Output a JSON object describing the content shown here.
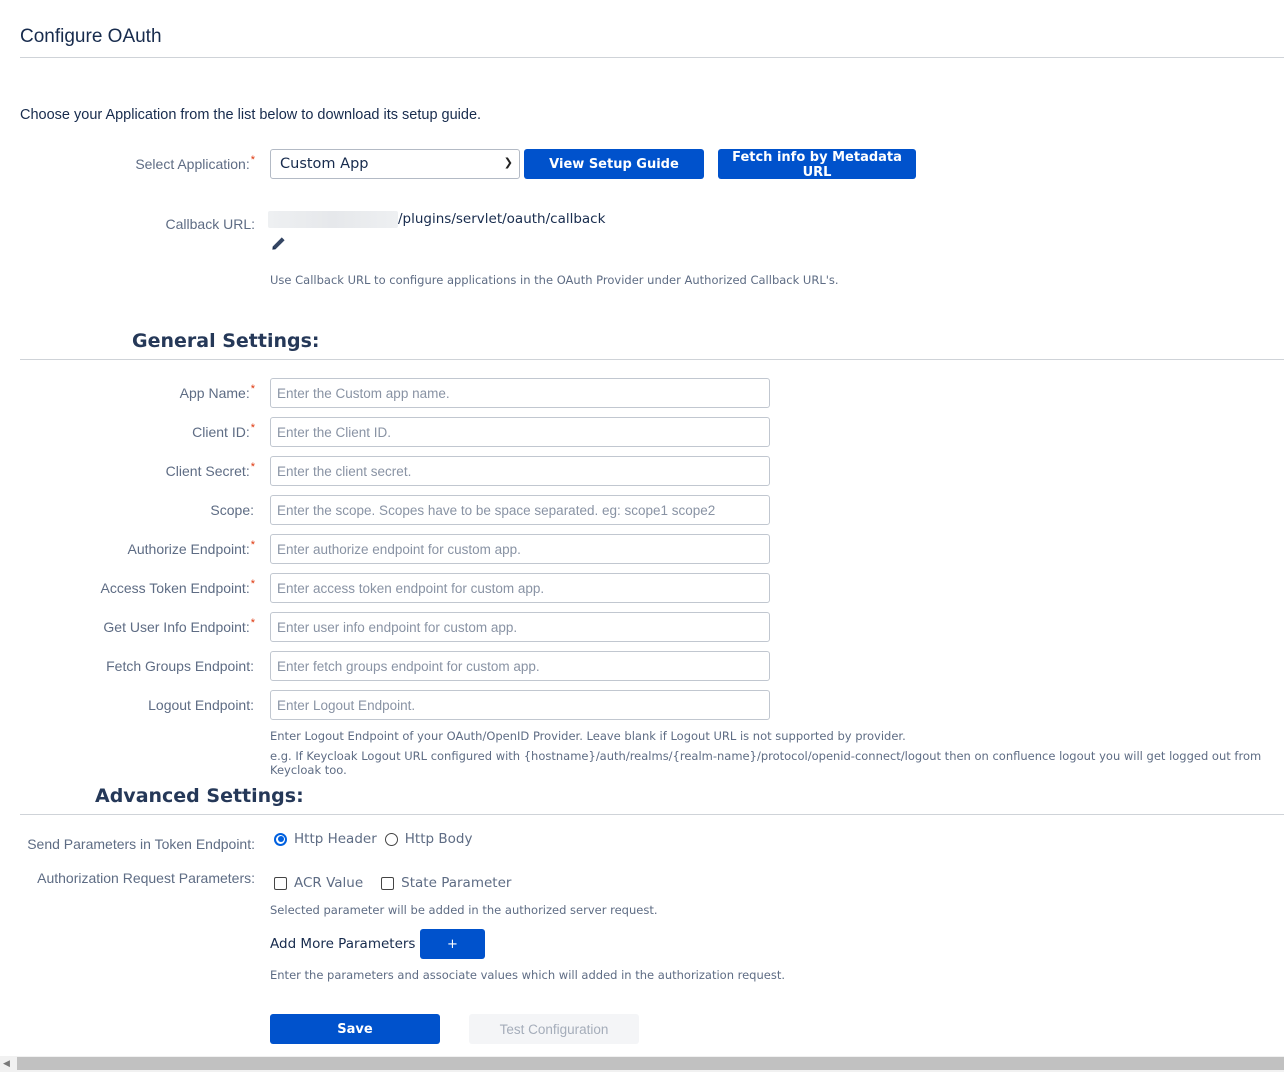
{
  "page": {
    "title": "Configure OAuth",
    "intro": "Choose your Application from the list below to download its setup guide."
  },
  "app_select": {
    "label": "Select Application:",
    "required": "*",
    "selected": "Custom App",
    "view_guide_label": "View Setup Guide",
    "fetch_metadata_label": "Fetch info by Metadata URL"
  },
  "callback": {
    "label": "Callback URL:",
    "url_suffix": "/plugins/servlet/oauth/callback",
    "help": "Use Callback URL to configure applications in the OAuth Provider under Authorized Callback URL's."
  },
  "general": {
    "title": "General Settings:",
    "fields": [
      {
        "label": "App Name:",
        "required": "*",
        "placeholder": "Enter the Custom app name.",
        "value": ""
      },
      {
        "label": "Client ID:",
        "required": "*",
        "placeholder": "Enter the Client ID.",
        "value": ""
      },
      {
        "label": "Client Secret:",
        "required": "*",
        "placeholder": "Enter the client secret.",
        "value": ""
      },
      {
        "label": "Scope:",
        "required": "",
        "placeholder": "Enter the scope. Scopes have to be space separated. eg: scope1 scope2",
        "value": ""
      },
      {
        "label": "Authorize Endpoint:",
        "required": "*",
        "placeholder": "Enter authorize endpoint for custom app.",
        "value": ""
      },
      {
        "label": "Access Token Endpoint:",
        "required": "*",
        "placeholder": "Enter access token endpoint for custom app.",
        "value": ""
      },
      {
        "label": "Get User Info Endpoint:",
        "required": "*",
        "placeholder": "Enter user info endpoint for custom app.",
        "value": ""
      },
      {
        "label": "Fetch Groups Endpoint:",
        "required": "",
        "placeholder": "Enter fetch groups endpoint for custom app.",
        "value": ""
      },
      {
        "label": "Logout Endpoint:",
        "required": "",
        "placeholder": "Enter Logout Endpoint.",
        "value": ""
      }
    ],
    "logout_help_1": "Enter Logout Endpoint of your OAuth/OpenID Provider. Leave blank if Logout URL is not supported by provider.",
    "logout_help_2": "e.g. If Keycloak Logout URL configured with {hostname}/auth/realms/{realm-name}/protocol/openid-connect/logout then on confluence logout you will get logged out from Keycloak too."
  },
  "advanced": {
    "title": "Advanced Settings:",
    "send_params_label": "Send Parameters in Token Endpoint:",
    "send_params_options": [
      {
        "label": "Http Header",
        "checked": true
      },
      {
        "label": "Http Body",
        "checked": false
      }
    ],
    "auth_req_label": "Authorization Request Parameters:",
    "auth_req_options": [
      {
        "label": "ACR Value",
        "checked": false
      },
      {
        "label": "State Parameter",
        "checked": false
      }
    ],
    "auth_req_help": "Selected parameter will be added in the authorized server request.",
    "add_more_label": "Add More Parameters",
    "add_button_label": "+",
    "add_more_help": "Enter the parameters and associate values which will added in the authorization request."
  },
  "actions": {
    "save_label": "Save",
    "test_label": "Test Configuration"
  },
  "colors": {
    "primary": "#0052cc",
    "required": "#de350b",
    "radio_checked": "#0060df"
  }
}
